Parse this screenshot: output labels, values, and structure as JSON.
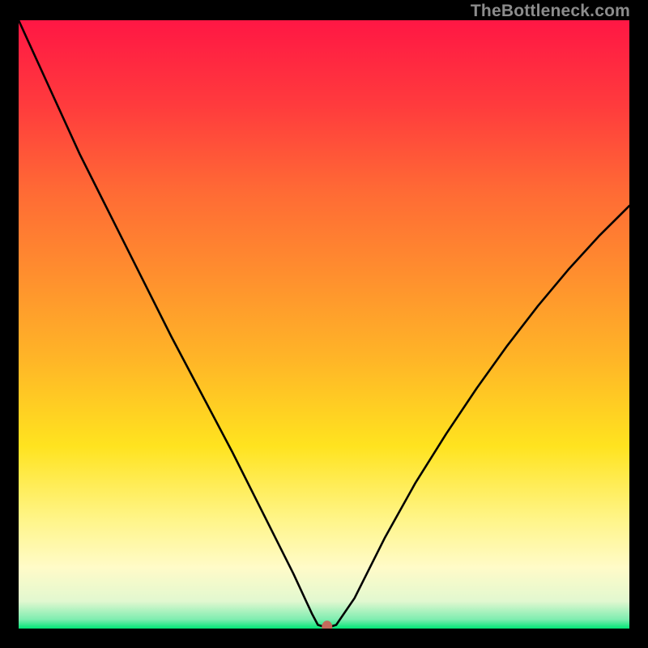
{
  "watermark": "TheBottleneck.com",
  "chart_data": {
    "type": "line",
    "title": "",
    "xlabel": "",
    "ylabel": "",
    "xlim": [
      0,
      100
    ],
    "ylim": [
      0,
      100
    ],
    "grid": false,
    "legend": false,
    "series": [
      {
        "name": "bottleneck-curve",
        "x": [
          0,
          5,
          10,
          15,
          20,
          25,
          30,
          35,
          40,
          45,
          48,
          49,
          50,
          51,
          52,
          55,
          60,
          65,
          70,
          75,
          80,
          85,
          90,
          95,
          100
        ],
        "values": [
          100,
          89,
          78,
          68,
          58,
          48,
          38.5,
          29,
          19,
          9,
          2.5,
          0.6,
          0.3,
          0.3,
          0.6,
          5,
          15,
          24,
          32,
          39.5,
          46.5,
          53,
          59,
          64.5,
          69.5
        ]
      }
    ],
    "marker": {
      "x": 50.5,
      "y": 0.3,
      "color": "#c46a5c"
    },
    "background_gradient": {
      "stops": [
        {
          "offset": 0.0,
          "color": "#ff1744"
        },
        {
          "offset": 0.14,
          "color": "#ff3b3d"
        },
        {
          "offset": 0.28,
          "color": "#ff6a35"
        },
        {
          "offset": 0.42,
          "color": "#ff8f2e"
        },
        {
          "offset": 0.56,
          "color": "#ffb627"
        },
        {
          "offset": 0.7,
          "color": "#ffe31f"
        },
        {
          "offset": 0.82,
          "color": "#fff588"
        },
        {
          "offset": 0.9,
          "color": "#fffbc8"
        },
        {
          "offset": 0.955,
          "color": "#e2f8d0"
        },
        {
          "offset": 0.985,
          "color": "#7eedb0"
        },
        {
          "offset": 1.0,
          "color": "#00e676"
        }
      ]
    }
  }
}
